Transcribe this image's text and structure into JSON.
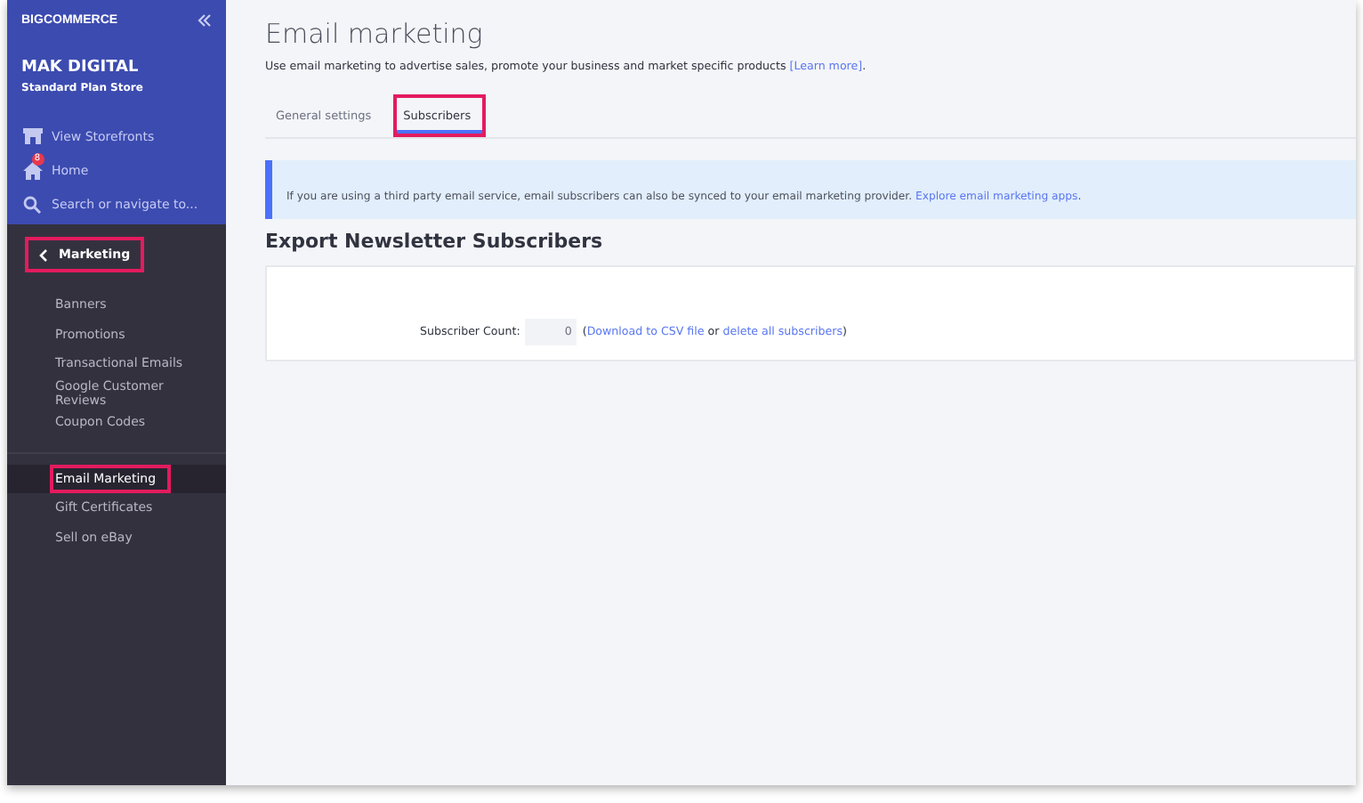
{
  "sidebar": {
    "logo": "BIGCOMMERCE",
    "store_name": "MAK DIGITAL",
    "store_plan": "Standard Plan Store",
    "nav": [
      {
        "kind": "storefront",
        "label": "View Storefronts"
      },
      {
        "kind": "home",
        "label": "Home",
        "badge": "8"
      },
      {
        "kind": "search",
        "label": "Search or navigate to..."
      }
    ],
    "section": {
      "label": "Marketing",
      "highlighted": true
    },
    "groups": [
      {
        "items": [
          {
            "label": "Banners",
            "selected": false,
            "highlighted": false
          },
          {
            "label": "Promotions",
            "selected": false,
            "highlighted": false
          },
          {
            "label": "Transactional Emails",
            "selected": false,
            "highlighted": false
          },
          {
            "label": "Google Customer Reviews",
            "selected": false,
            "highlighted": false
          },
          {
            "label": "Coupon Codes",
            "selected": false,
            "highlighted": false
          }
        ]
      },
      {
        "items": [
          {
            "label": "Email Marketing",
            "selected": true,
            "highlighted": true
          },
          {
            "label": "Gift Certificates",
            "selected": false,
            "highlighted": false
          },
          {
            "label": "Sell on eBay",
            "selected": false,
            "highlighted": false
          }
        ]
      }
    ]
  },
  "page": {
    "title": "Email marketing",
    "description": "Use email marketing to advertise sales, promote your business and market specific products ",
    "learn_more": "[Learn more]",
    "description_end": ".",
    "tabs": [
      {
        "label": "General settings",
        "selected": false,
        "highlighted": false
      },
      {
        "label": "Subscribers",
        "selected": true,
        "highlighted": true
      }
    ],
    "alert": {
      "text": "If you are using a third party email service, email subscribers can also be synced to your email marketing provider. ",
      "link": "Explore email marketing apps",
      "end": "."
    },
    "section_title": "Export Newsletter Subscribers",
    "count_label": "Subscriber Count:",
    "count_value": "0",
    "paren_open": "(",
    "download_link": "Download to CSV file",
    "or": " or ",
    "delete_link": "delete all subscribers",
    "paren_close": ")"
  }
}
